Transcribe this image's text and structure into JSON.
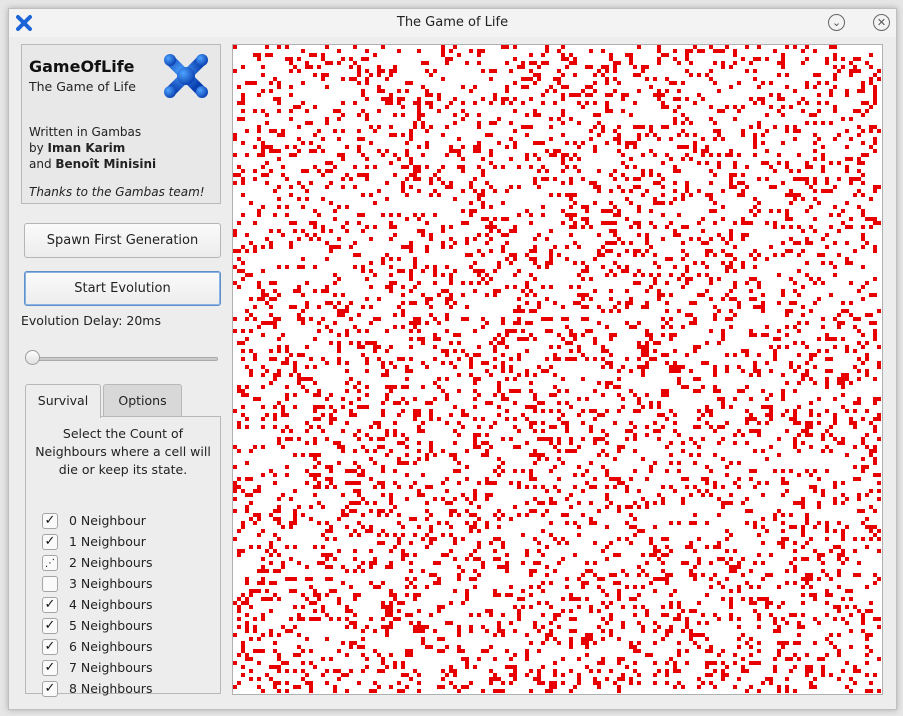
{
  "window": {
    "title": "The Game of Life"
  },
  "icons": {
    "app": "gambas-logo-icon",
    "minimize": "chevron-down-icon",
    "close": "close-icon",
    "check": "check-icon",
    "indeterminate": "partial-check-icon"
  },
  "info": {
    "app_name": "GameOfLife",
    "subtitle": "The Game of Life",
    "written_in": "Written in Gambas",
    "by_prefix": "by ",
    "author1": "Iman Karim",
    "and_prefix": "and ",
    "author2": "Benoît Minisini",
    "thanks": "Thanks to the Gambas team!"
  },
  "buttons": {
    "spawn": "Spawn First Generation",
    "start": "Start Evolution"
  },
  "delay": {
    "label": "Evolution Delay: 20ms",
    "value": 20,
    "slider_fraction": 0.0
  },
  "tabs": [
    {
      "label": "Survival",
      "active": true
    },
    {
      "label": "Options",
      "active": false
    }
  ],
  "survival": {
    "description": "Select the Count of Neighbours where a cell will die or keep its state.",
    "options": [
      {
        "label": "0 Neighbour",
        "state": "checked"
      },
      {
        "label": "1 Neighbour",
        "state": "checked"
      },
      {
        "label": "2 Neighbours",
        "state": "partial"
      },
      {
        "label": "3 Neighbours",
        "state": "unchecked"
      },
      {
        "label": "4 Neighbours",
        "state": "checked"
      },
      {
        "label": "5 Neighbours",
        "state": "checked"
      },
      {
        "label": "6 Neighbours",
        "state": "checked"
      },
      {
        "label": "7 Neighbours",
        "state": "checked"
      },
      {
        "label": "8 Neighbours",
        "state": "checked"
      }
    ]
  },
  "board": {
    "cell_color": "#e80000",
    "background": "#ffffff",
    "live_fraction": 0.17
  },
  "colors": {
    "accent": "#5f8fc9",
    "logo": "#1a64d8"
  }
}
